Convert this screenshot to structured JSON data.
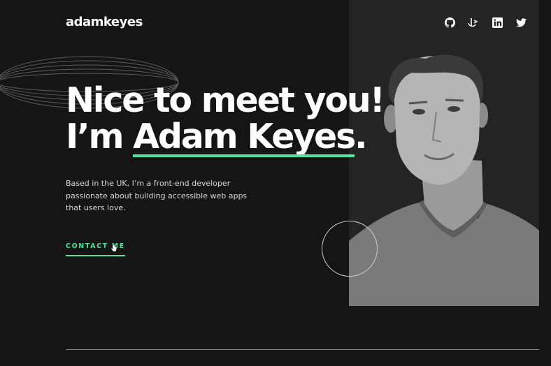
{
  "header": {
    "logo": "adamkeyes",
    "socials": [
      {
        "name": "github",
        "icon": "github-icon"
      },
      {
        "name": "frontend-mentor",
        "icon": "frontend-mentor-icon"
      },
      {
        "name": "linkedin",
        "icon": "linkedin-icon"
      },
      {
        "name": "twitter",
        "icon": "twitter-icon"
      }
    ]
  },
  "hero": {
    "line1": "Nice to meet you!",
    "line2_prefix": "I’m ",
    "name": "Adam Keyes",
    "line2_suffix": ".",
    "intro": "Based in the UK, I’m a front-end developer passionate about building accessible web apps that users love.",
    "cta_label": "CONTACT ME"
  },
  "colors": {
    "background": "#151515",
    "panel": "#242424",
    "accent": "#4ee1a0",
    "text": "#ffffff",
    "muted": "#d9d9d9"
  }
}
